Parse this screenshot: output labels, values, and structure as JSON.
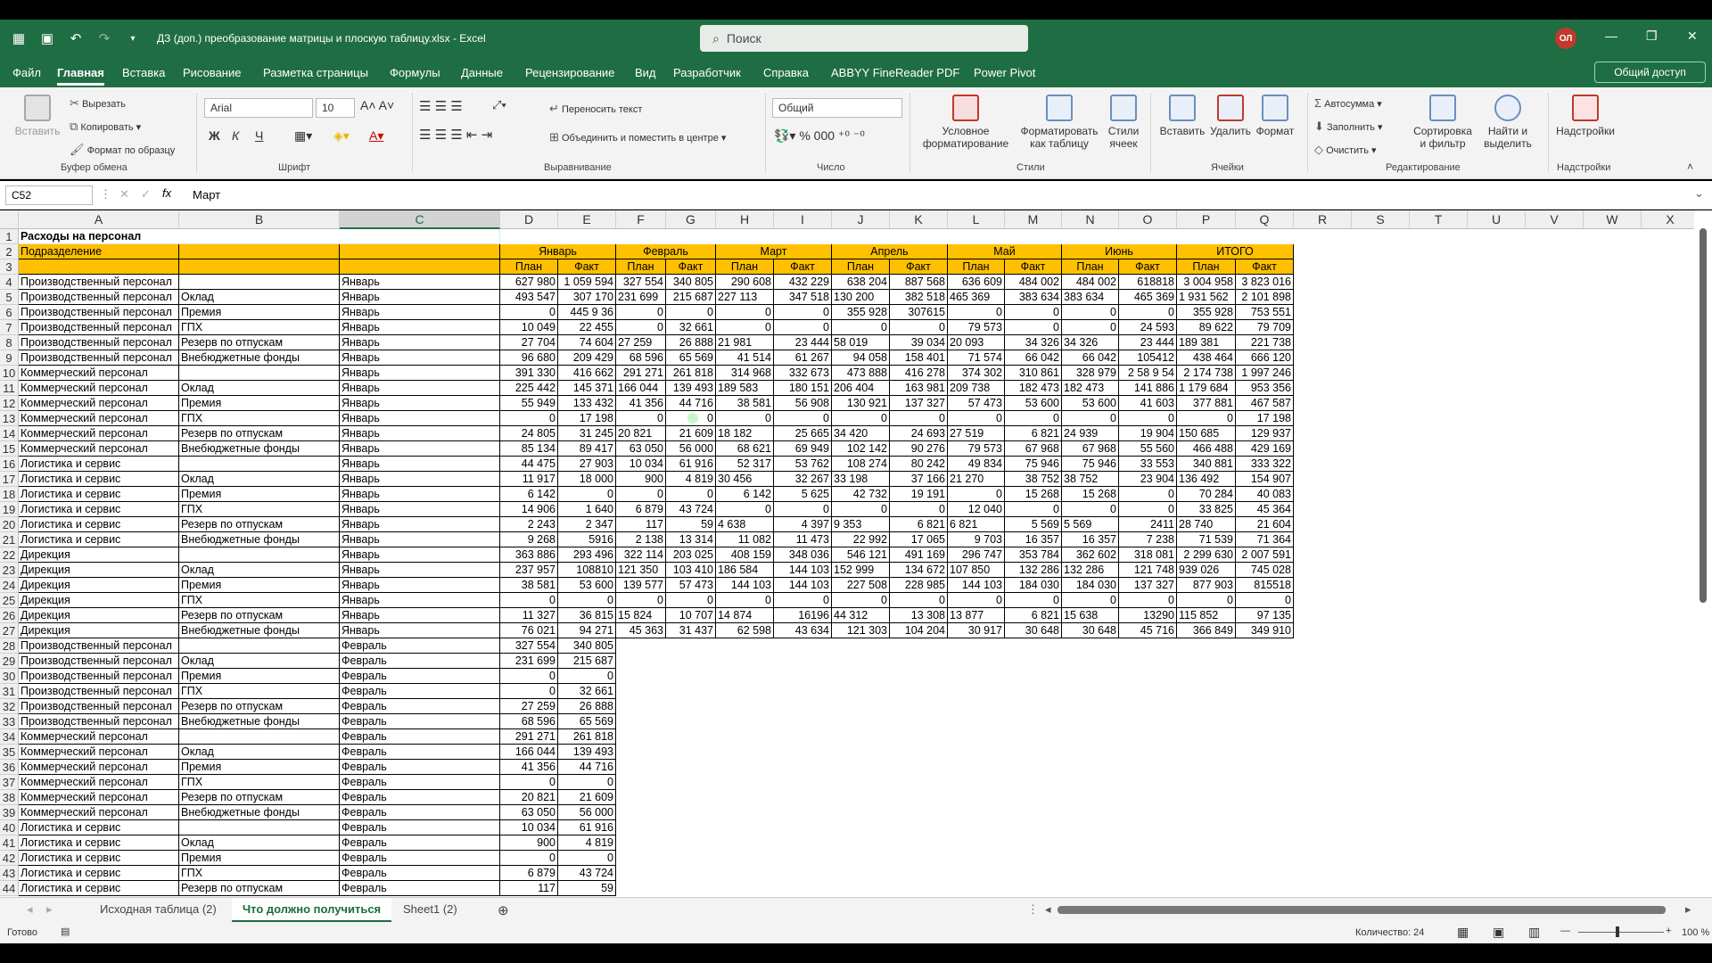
{
  "window": {
    "title": "ДЗ (доп.) преобразование матрицы и плоскую таблицу.xlsx  -  Excel",
    "search_placeholder": "Поиск",
    "avatar": "ОЛ",
    "share": "Общий доступ"
  },
  "tabs": [
    "Файл",
    "Главная",
    "Вставка",
    "Рисование",
    "Разметка страницы",
    "Формулы",
    "Данные",
    "Рецензирование",
    "Вид",
    "Разработчик",
    "Справка",
    "ABBYY FineReader PDF",
    "Power Pivot"
  ],
  "ribbon": {
    "clipboard": {
      "paste": "Вставить",
      "cut": "Вырезать",
      "copy": "Копировать",
      "format_painter": "Формат по образцу",
      "label": "Буфер обмена"
    },
    "font": {
      "name": "Arial",
      "size": "10",
      "label": "Шрифт",
      "bold": "Ж",
      "italic": "К",
      "underline": "Ч"
    },
    "alignment": {
      "wrap": "Переносить текст",
      "merge": "Объединить и поместить в центре",
      "label": "Выравнивание"
    },
    "number": {
      "format": "Общий",
      "label": "Число"
    },
    "styles": {
      "conditional": "Условное форматирование",
      "as_table": "Форматировать как таблицу",
      "cell_styles": "Стили ячеек",
      "label": "Стили"
    },
    "cells": {
      "insert": "Вставить",
      "delete": "Удалить",
      "format": "Формат",
      "label": "Ячейки"
    },
    "editing": {
      "autosum": "Автосумма",
      "fill": "Заполнить",
      "clear": "Очистить",
      "sort": "Сортировка и фильтр",
      "find": "Найти и выделить",
      "label": "Редактирование"
    },
    "addins": {
      "btn": "Надстройки",
      "label": "Надстройки"
    }
  },
  "formula_bar": {
    "name_box": "C52",
    "value": "Март"
  },
  "columns": [
    "A",
    "B",
    "C",
    "D",
    "E",
    "F",
    "G",
    "H",
    "I",
    "J",
    "K",
    "L",
    "M",
    "N",
    "O",
    "P",
    "Q",
    "R",
    "S",
    "T",
    "U",
    "V",
    "W",
    "X"
  ],
  "header_rows": {
    "title": "Расходы на персонал",
    "dept": "Подразделение",
    "months": [
      "Январь",
      "Февраль",
      "Март",
      "Апрель",
      "Май",
      "Июнь",
      "ИТОГО"
    ],
    "plan": "План",
    "fact": "Факт"
  },
  "rows": [
    [
      "Производственный персонал",
      "",
      "Январь",
      "627 980",
      "1 059 594",
      "327 554",
      "340 805",
      "290 608",
      "432 229",
      "638 204",
      "887 568",
      "636 609",
      "484 002",
      "484 002",
      "618818",
      "3 004 958",
      "3 823 016"
    ],
    [
      "Производственный персонал",
      "Оклад",
      "Январь",
      "493 547",
      "307 170",
      "231 699",
      "215 687",
      "227 113",
      "347 518",
      "130 200",
      "382 518",
      "465 369",
      "383 634",
      "383 634",
      "465 369",
      "1 931 562",
      "2 101 898"
    ],
    [
      "Производственный персонал",
      "Премия",
      "Январь",
      "0",
      "445 9 36",
      "0",
      "0",
      "0",
      "0",
      "355 928",
      "307615",
      "0",
      "0",
      "0",
      "0",
      "355 928",
      "753 551"
    ],
    [
      "Производственный персонал",
      "ГПХ",
      "Январь",
      "10 049",
      "22 455",
      "0",
      "32 661",
      "0",
      "0",
      "0",
      "0",
      "79 573",
      "0",
      "0",
      "24 593",
      "89 622",
      "79 709"
    ],
    [
      "Производственный персонал",
      "Резерв по отпускам",
      "Январь",
      "27 704",
      "74 604",
      "27 259",
      "26 888",
      "21 981",
      "23 444",
      "58 019",
      "39 034",
      "20 093",
      "34 326",
      "34 326",
      "23 444",
      "189 381",
      "221 738"
    ],
    [
      "Производственный персонал",
      "Внебюджетные фонды",
      "Январь",
      "96 680",
      "209 429",
      "68 596",
      "65 569",
      "41 514",
      "61 267",
      "94 058",
      "158 401",
      "71 574",
      "66 042",
      "66 042",
      "105412",
      "438 464",
      "666 120"
    ],
    [
      "Коммерческий персонал",
      "",
      "Январь",
      "391 330",
      "416 662",
      "291 271",
      "261 818",
      "314 968",
      "332 673",
      "473 888",
      "416 278",
      "374 302",
      "310 861",
      "328 979",
      "2 58 9 54",
      "2 174 738",
      "1 997 246"
    ],
    [
      "Коммерческий персонал",
      "Оклад",
      "Январь",
      "225 442",
      "145 371",
      "166 044",
      "139 493",
      "189 583",
      "180 151",
      "206 404",
      "163 981",
      "209 738",
      "182 473",
      "182 473",
      "141 886",
      "1 179 684",
      "953 356"
    ],
    [
      "Коммерческий персонал",
      "Премия",
      "Январь",
      "55 949",
      "133 432",
      "41 356",
      "44 716",
      "38 581",
      "56 908",
      "130 921",
      "137 327",
      "57 473",
      "53 600",
      "53 600",
      "41 603",
      "377 881",
      "467 587"
    ],
    [
      "Коммерческий персонал",
      "ГПХ",
      "Январь",
      "0",
      "17 198",
      "0",
      "0",
      "0",
      "0",
      "0",
      "0",
      "0",
      "0",
      "0",
      "0",
      "0",
      "17 198"
    ],
    [
      "Коммерческий персонал",
      "Резерв по отпускам",
      "Январь",
      "24 805",
      "31 245",
      "20 821",
      "21 609",
      "18 182",
      "25 665",
      "34 420",
      "24 693",
      "27 519",
      "6 821",
      "24 939",
      "19 904",
      "150 685",
      "129 937"
    ],
    [
      "Коммерческий персонал",
      "Внебюджетные фонды",
      "Январь",
      "85 134",
      "89 417",
      "63 050",
      "56 000",
      "68 621",
      "69 949",
      "102 142",
      "90 276",
      "79 573",
      "67 968",
      "67 968",
      "55 560",
      "466 488",
      "429 169"
    ],
    [
      "Логистика и сервис",
      "",
      "Январь",
      "44 475",
      "27 903",
      "10 034",
      "61 916",
      "52 317",
      "53 762",
      "108 274",
      "80 242",
      "49 834",
      "75 946",
      "75 946",
      "33 553",
      "340 881",
      "333 322"
    ],
    [
      "Логистика и сервис",
      "Оклад",
      "Январь",
      "11 917",
      "18 000",
      "900",
      "4 819",
      "30 456",
      "32 267",
      "33 198",
      "37 166",
      "21 270",
      "38 752",
      "38 752",
      "23 904",
      "136 492",
      "154 907"
    ],
    [
      "Логистика и сервис",
      "Премия",
      "Январь",
      "6 142",
      "0",
      "0",
      "0",
      "6 142",
      "5 625",
      "42 732",
      "19 191",
      "0",
      "15 268",
      "15 268",
      "0",
      "70 284",
      "40 083"
    ],
    [
      "Логистика и сервис",
      "ГПХ",
      "Январь",
      "14 906",
      "1 640",
      "6 879",
      "43 724",
      "0",
      "0",
      "0",
      "0",
      "12 040",
      "0",
      "0",
      "0",
      "33 825",
      "45 364"
    ],
    [
      "Логистика и сервис",
      "Резерв по отпускам",
      "Январь",
      "2 243",
      "2 347",
      "117",
      "59",
      "4 638",
      "4 397",
      "9 353",
      "6 821",
      "6 821",
      "5 569",
      "5 569",
      "2411",
      "28 740",
      "21 604"
    ],
    [
      "Логистика и сервис",
      "Внебюджетные фонды",
      "Январь",
      "9 268",
      "5916",
      "2 138",
      "13 314",
      "11 082",
      "11 473",
      "22 992",
      "17 065",
      "9 703",
      "16 357",
      "16 357",
      "7 238",
      "71 539",
      "71 364"
    ],
    [
      "Дирекция",
      "",
      "Январь",
      "363 886",
      "293 496",
      "322 114",
      "203 025",
      "408 159",
      "348 036",
      "546 121",
      "491 169",
      "296 747",
      "353 784",
      "362 602",
      "318 081",
      "2 299 630",
      "2 007 591"
    ],
    [
      "Дирекция",
      "Оклад",
      "Январь",
      "237 957",
      "108810",
      "121 350",
      "103 410",
      "186 584",
      "144 103",
      "152 999",
      "134 672",
      "107 850",
      "132 286",
      "132 286",
      "121 748",
      "939 026",
      "745 028"
    ],
    [
      "Дирекция",
      "Премия",
      "Январь",
      "38 581",
      "53 600",
      "139 577",
      "57 473",
      "144 103",
      "144 103",
      "227 508",
      "228 985",
      "144 103",
      "184 030",
      "184 030",
      "137 327",
      "877 903",
      "815518"
    ],
    [
      "Дирекция",
      "ГПХ",
      "Январь",
      "0",
      "0",
      "0",
      "0",
      "0",
      "0",
      "0",
      "0",
      "0",
      "0",
      "0",
      "0",
      "0",
      "0"
    ],
    [
      "Дирекция",
      "Резерв по отпускам",
      "Январь",
      "11 327",
      "36 815",
      "15 824",
      "10 707",
      "14 874",
      "16196",
      "44 312",
      "13 308",
      "13 877",
      "6 821",
      "15 638",
      "13290",
      "115 852",
      "97 135"
    ],
    [
      "Дирекция",
      "Внебюджетные фонды",
      "Январь",
      "76 021",
      "94 271",
      "45 363",
      "31 437",
      "62 598",
      "43 634",
      "121 303",
      "104 204",
      "30 917",
      "30 648",
      "30 648",
      "45 716",
      "366 849",
      "349 910"
    ],
    [
      "Производственный персонал",
      "",
      "Февраль",
      "327 554",
      "340 805"
    ],
    [
      "Производственный персонал",
      "Оклад",
      "Февраль",
      "231 699",
      "215 687"
    ],
    [
      "Производственный персонал",
      "Премия",
      "Февраль",
      "0",
      "0"
    ],
    [
      "Производственный персонал",
      "ГПХ",
      "Февраль",
      "0",
      "32 661"
    ],
    [
      "Производственный персонал",
      "Резерв по отпускам",
      "Февраль",
      "27 259",
      "26 888"
    ],
    [
      "Производственный персонал",
      "Внебюджетные фонды",
      "Февраль",
      "68 596",
      "65 569"
    ],
    [
      "Коммерческий персонал",
      "",
      "Февраль",
      "291 271",
      "261 818"
    ],
    [
      "Коммерческий персонал",
      "Оклад",
      "Февраль",
      "166 044",
      "139 493"
    ],
    [
      "Коммерческий персонал",
      "Премия",
      "Февраль",
      "41 356",
      "44 716"
    ],
    [
      "Коммерческий персонал",
      "ГПХ",
      "Февраль",
      "0",
      "0"
    ],
    [
      "Коммерческий персонал",
      "Резерв по отпускам",
      "Февраль",
      "20 821",
      "21 609"
    ],
    [
      "Коммерческий персонал",
      "Внебюджетные фонды",
      "Февраль",
      "63 050",
      "56 000"
    ],
    [
      "Логистика и сервис",
      "",
      "Февраль",
      "10 034",
      "61 916"
    ],
    [
      "Логистика и сервис",
      "Оклад",
      "Февраль",
      "900",
      "4 819"
    ],
    [
      "Логистика и сервис",
      "Премия",
      "Февраль",
      "0",
      "0"
    ],
    [
      "Логистика и сервис",
      "ГПХ",
      "Февраль",
      "6 879",
      "43 724"
    ],
    [
      "Логистика и сервис",
      "Резерв по отпускам",
      "Февраль",
      "117",
      "59"
    ]
  ],
  "sheet_tabs": [
    "Исходная таблица (2)",
    "Что должно получиться",
    "Sheet1 (2)"
  ],
  "status": {
    "ready": "Готово",
    "count": "Количество: 24",
    "zoom": "100 %"
  }
}
